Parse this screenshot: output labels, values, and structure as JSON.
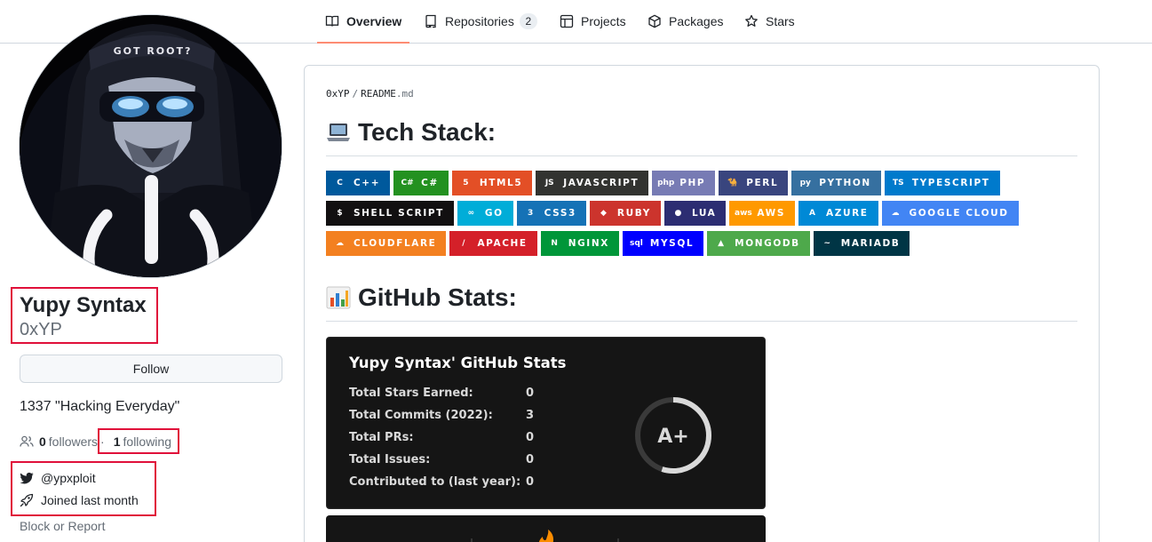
{
  "nav": {
    "tabs": [
      {
        "label": "Overview",
        "icon": "book-icon",
        "active": true
      },
      {
        "label": "Repositories",
        "icon": "repo-icon",
        "count": "2"
      },
      {
        "label": "Projects",
        "icon": "table-icon"
      },
      {
        "label": "Packages",
        "icon": "package-icon"
      },
      {
        "label": "Stars",
        "icon": "star-icon"
      }
    ]
  },
  "profile": {
    "name": "Yupy Syntax",
    "username": "0xYP",
    "follow_label": "Follow",
    "bio": "1337 \"Hacking Everyday\"",
    "followers_count": "0",
    "followers_label": "followers",
    "separator": "·",
    "following_count": "1",
    "following_label": "following",
    "twitter": "@ypxploit",
    "joined": "Joined last month",
    "block_report": "Block or Report",
    "avatar_text": "GOT ROOT?"
  },
  "readme": {
    "owner": "0xYP",
    "sep": "/",
    "file": "README",
    "ext": ".md",
    "tech_heading": "Tech Stack:",
    "stats_heading": "GitHub Stats:",
    "badges": [
      [
        {
          "label": "C++",
          "color": "#00599C",
          "icon": "C"
        },
        {
          "label": "C#",
          "color": "#239120",
          "icon": "C#"
        },
        {
          "label": "HTML5",
          "color": "#E34F26",
          "icon": "5"
        },
        {
          "label": "JAVASCRIPT",
          "color": "#323330",
          "icon": "JS"
        },
        {
          "label": "PHP",
          "color": "#777BB4",
          "icon": "php"
        },
        {
          "label": "PERL",
          "color": "#39457E",
          "icon": "🐪"
        },
        {
          "label": "PYTHON",
          "color": "#3670A0",
          "icon": "py"
        },
        {
          "label": "TYPESCRIPT",
          "color": "#007ACC",
          "icon": "TS"
        }
      ],
      [
        {
          "label": "SHELL SCRIPT",
          "color": "#121011",
          "icon": "$"
        },
        {
          "label": "GO",
          "color": "#00ADD8",
          "icon": "∞"
        },
        {
          "label": "CSS3",
          "color": "#1572B6",
          "icon": "3"
        },
        {
          "label": "RUBY",
          "color": "#CC342D",
          "icon": "◆"
        },
        {
          "label": "LUA",
          "color": "#2C2D72",
          "icon": "●"
        },
        {
          "label": "AWS",
          "color": "#FF9900",
          "icon": "aws"
        },
        {
          "label": "AZURE",
          "color": "#0089D6",
          "icon": "A"
        },
        {
          "label": "GOOGLE CLOUD",
          "color": "#4285F4",
          "icon": "☁"
        }
      ],
      [
        {
          "label": "CLOUDFLARE",
          "color": "#F38020",
          "icon": "☁"
        },
        {
          "label": "APACHE",
          "color": "#D42029",
          "icon": "/"
        },
        {
          "label": "NGINX",
          "color": "#009639",
          "icon": "N"
        },
        {
          "label": "MYSQL",
          "color": "#00F",
          "icon": "sql"
        },
        {
          "label": "MONGODB",
          "color": "#4EA94B",
          "icon": "▲"
        },
        {
          "label": "MARIADB",
          "color": "#003545",
          "icon": "~"
        }
      ]
    ]
  },
  "stats_card": {
    "title": "Yupy Syntax' GitHub Stats",
    "rows": [
      {
        "label": "Total Stars Earned:",
        "value": "0"
      },
      {
        "label": "Total Commits (2022):",
        "value": "3"
      },
      {
        "label": "Total PRs:",
        "value": "0"
      },
      {
        "label": "Total Issues:",
        "value": "0"
      },
      {
        "label": "Contributed to (last year):",
        "value": "0"
      }
    ],
    "rank": "A+",
    "rank_progress": 0.55
  },
  "colors": {
    "accent_underline": "#fd8c73",
    "highlight_box": "#e0103a"
  }
}
